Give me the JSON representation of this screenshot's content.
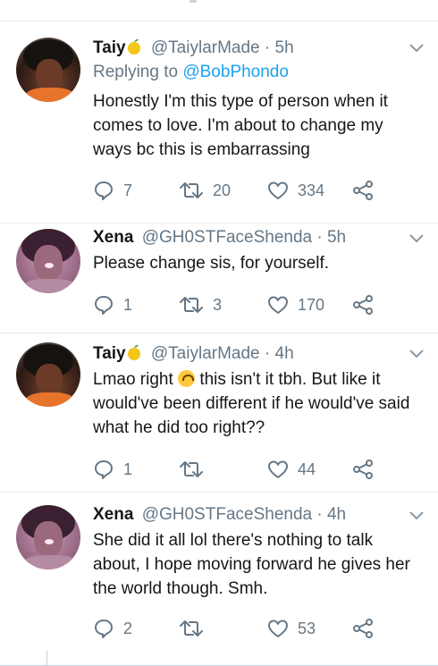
{
  "tweets": [
    {
      "name": "Taiy",
      "handle": "@TaiylarMade",
      "sep": "·",
      "time": "5h",
      "replying_prefix": "Replying to",
      "replying_to": "@BobPhondo",
      "text": "Honestly I'm this type of person when it comes to love. I'm about to change my ways bc this is embarrassing",
      "replies": "7",
      "retweets": "20",
      "likes": "334"
    },
    {
      "name": "Xena",
      "handle": "@GH0STFaceShenda",
      "sep": "·",
      "time": "5h",
      "text": "Please change sis, for yourself.",
      "replies": "1",
      "retweets": "3",
      "likes": "170"
    },
    {
      "name": "Taiy",
      "handle": "@TaiylarMade",
      "sep": "·",
      "time": "4h",
      "text_before": "Lmao right ",
      "text_after": " this isn't it tbh. But like it would've been different if he would've said what he did too right??",
      "replies": "1",
      "retweets": "",
      "likes": "44"
    },
    {
      "name": "Xena",
      "handle": "@GH0STFaceShenda",
      "sep": "·",
      "time": "4h",
      "text": "She did it all lol there's nothing to talk about, I hope moving forward he gives her the world though. Smh.",
      "replies": "2",
      "retweets": "",
      "likes": "53"
    }
  ],
  "icons": {
    "reply": "reply-icon",
    "retweet": "retweet-icon",
    "like": "heart-icon",
    "share": "share-icon",
    "caret": "chevron-down-icon",
    "name_badge": "mango-emoji-icon",
    "upside_down": "upside-down-face-emoji-icon"
  },
  "colors": {
    "text": "#14171a",
    "secondary": "#657786",
    "link": "#1da1f2",
    "divider": "#e6ecf0"
  }
}
